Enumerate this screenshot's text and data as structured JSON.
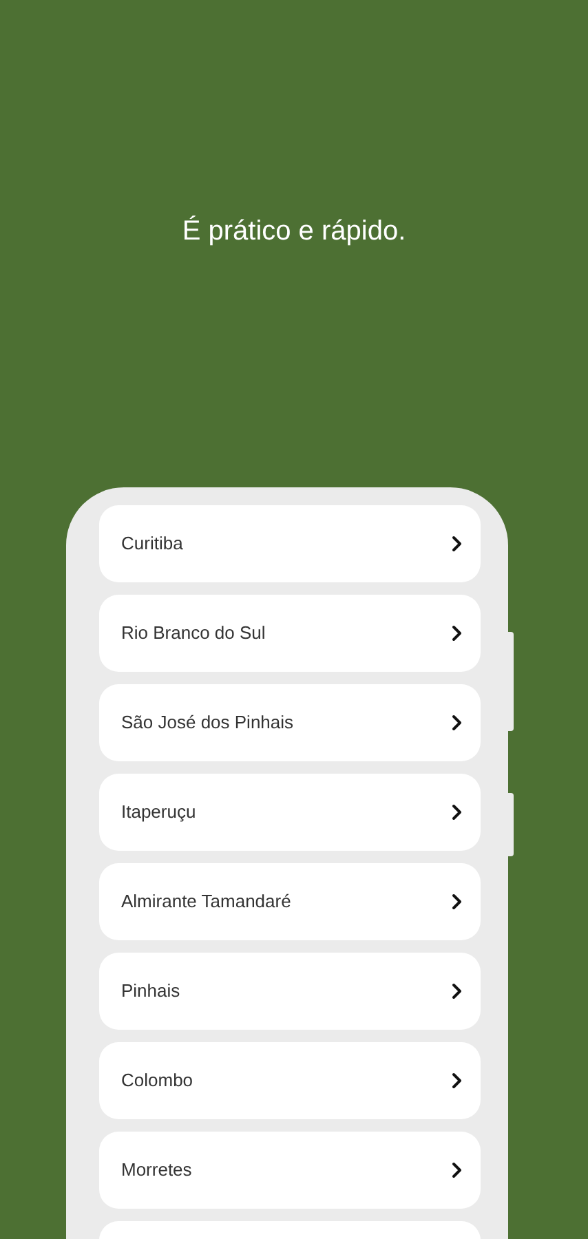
{
  "headline": "É prático e rápido.",
  "cities": [
    {
      "name": "Curitiba"
    },
    {
      "name": "Rio Branco do Sul"
    },
    {
      "name": "São José dos Pinhais"
    },
    {
      "name": "Itaperuçu"
    },
    {
      "name": "Almirante Tamandaré"
    },
    {
      "name": "Pinhais"
    },
    {
      "name": "Colombo"
    },
    {
      "name": "Morretes"
    }
  ]
}
